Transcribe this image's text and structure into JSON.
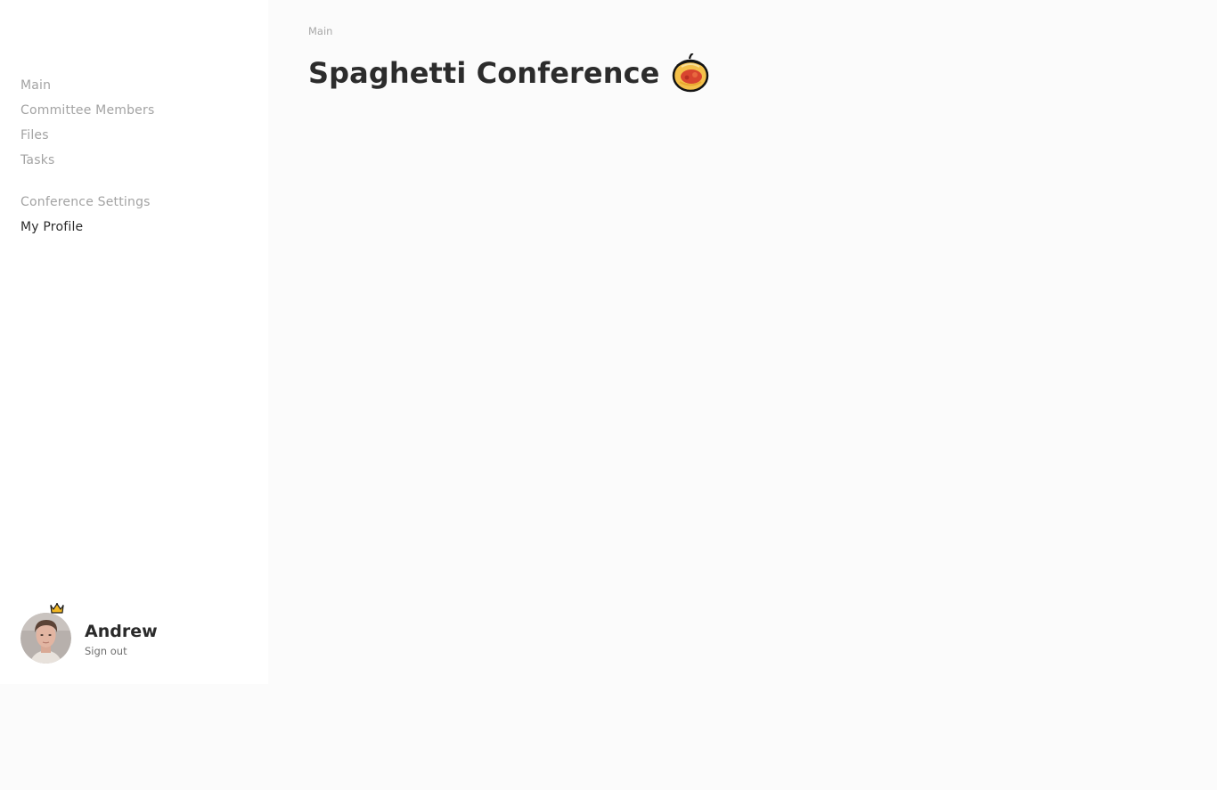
{
  "sidebar": {
    "nav_primary": [
      {
        "label": "Main"
      },
      {
        "label": "Committee Members"
      },
      {
        "label": "Files"
      },
      {
        "label": "Tasks"
      }
    ],
    "nav_secondary": [
      {
        "label": "Conference Settings"
      },
      {
        "label": "My Profile",
        "active": true
      }
    ],
    "user": {
      "name": "Andrew",
      "signout_label": "Sign out",
      "badge_icon": "crown-icon"
    }
  },
  "main": {
    "breadcrumb": "Main",
    "title": "Spaghetti Conference",
    "title_icon": "spaghetti-icon"
  },
  "colors": {
    "sidebar_bg": "#ffffff",
    "page_bg": "#fbfbfb",
    "nav_inactive": "#a3a3a3",
    "nav_active": "#2c2c2c",
    "title": "#2c2c2c"
  }
}
